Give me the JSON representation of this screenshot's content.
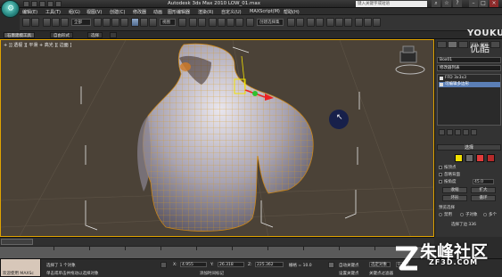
{
  "window": {
    "title": "Autodesk 3ds Max  2010     LOW_01.max",
    "search_placeholder": "键入关键字或短语"
  },
  "menubar": {
    "items": [
      "编辑(E)",
      "工具(T)",
      "组(G)",
      "视图(V)",
      "创建(C)",
      "修改器",
      "动画",
      "图形编辑器",
      "渲染(R)",
      "自定义(U)",
      "MAXScript(M)",
      "帮助(H)"
    ]
  },
  "toolbar": {
    "selection_filter": "全部",
    "coord_system": "视图",
    "named_selection": "创建选择集"
  },
  "ribbon": {
    "tabs": [
      "石墨建模工具",
      "自由形式",
      "选择"
    ]
  },
  "viewport": {
    "label": "+ ]] 透视 ][ 平滑 + 高光 ][ 边面 ]"
  },
  "command_panel": {
    "object_name": "Box01",
    "modifier_list": "修改器列表",
    "stack": [
      {
        "label": "FFD 3x3x3",
        "selected": false
      },
      {
        "label": "可编辑多边形",
        "selected": true
      }
    ],
    "selection_rollout": {
      "title": "选择",
      "by_vertex": "按顶点",
      "ignore_backfacing": "忽略背面",
      "by_angle": "按角度",
      "angle_value": "45.0",
      "shrink": "收缩",
      "grow": "扩大",
      "ring": "环形",
      "loop": "循环",
      "preview_title": "预览选择",
      "preview_off": "禁用",
      "preview_subobj": "子对象",
      "preview_multi": "多个",
      "status": "选择了边 336"
    },
    "colors": {
      "vertex_btn": "#f2e100",
      "edge_btn": "#e23b3b",
      "border_btn": "#e23b3b"
    }
  },
  "timeline": {
    "frame": "0 / 100"
  },
  "statusbar": {
    "listener": "欢迎使用 MAXSc",
    "selected": "选择了 1 个对象",
    "x_label": "X:",
    "x_value": "4.955",
    "y_label": "Y:",
    "y_value": "26.318",
    "z_label": "Z:",
    "z_value": "225.362",
    "grid": "栅格 = 10.0",
    "auto_key": "自动关键点",
    "selected_obj": "选定对象",
    "set_key": "设置关键点",
    "key_filters": "关键点过滤器",
    "frame_value": "0",
    "add_time_tag": "添加时间标记",
    "prompt": "单击或单击并拖动以选择对象"
  },
  "watermark": {
    "youku": "YOUKU",
    "youku_cn": "优酷",
    "site_cn": "朱峰社区",
    "site_url": "ZF3D.COM"
  }
}
